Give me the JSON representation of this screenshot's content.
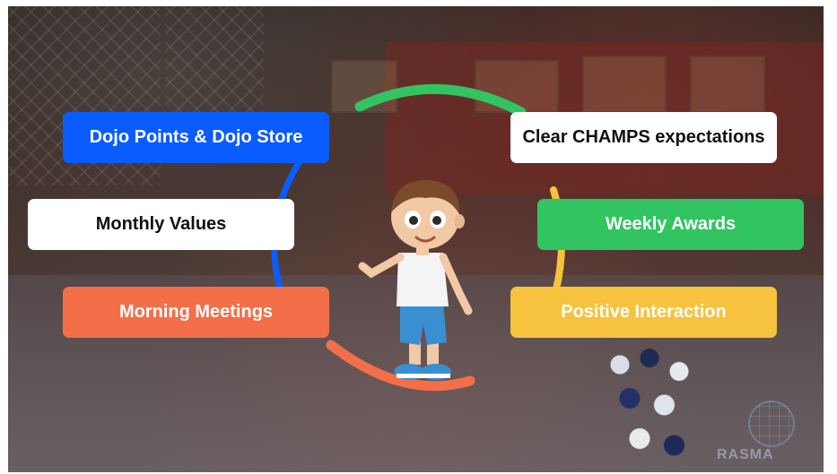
{
  "items": {
    "dojo_points": {
      "label": "Dojo Points & Dojo Store",
      "color": "#0b5cff",
      "text_color": "#ffffff"
    },
    "monthly_values": {
      "label": "Monthly Values",
      "color": "#ffffff",
      "text_color": "#111111"
    },
    "morning_meetings": {
      "label": "Morning Meetings",
      "color": "#f26f4a",
      "text_color": "#ffffff"
    },
    "champs": {
      "label": "Clear CHAMPS expectations",
      "color": "#ffffff",
      "text_color": "#111111"
    },
    "weekly_awards": {
      "label": "Weekly Awards",
      "color": "#33c462",
      "text_color": "#ffffff"
    },
    "positive_interaction": {
      "label": "Positive Interaction",
      "color": "#f7c23e",
      "text_color": "#ffffff"
    }
  },
  "arc_colors": {
    "green": "#33c462",
    "blue": "#0b5cff",
    "yellow": "#f7c23e",
    "orange": "#f26f4a"
  },
  "logo": {
    "text": "RASMA"
  },
  "icons": [
    "character-illustration",
    "globe-logo-icon"
  ]
}
